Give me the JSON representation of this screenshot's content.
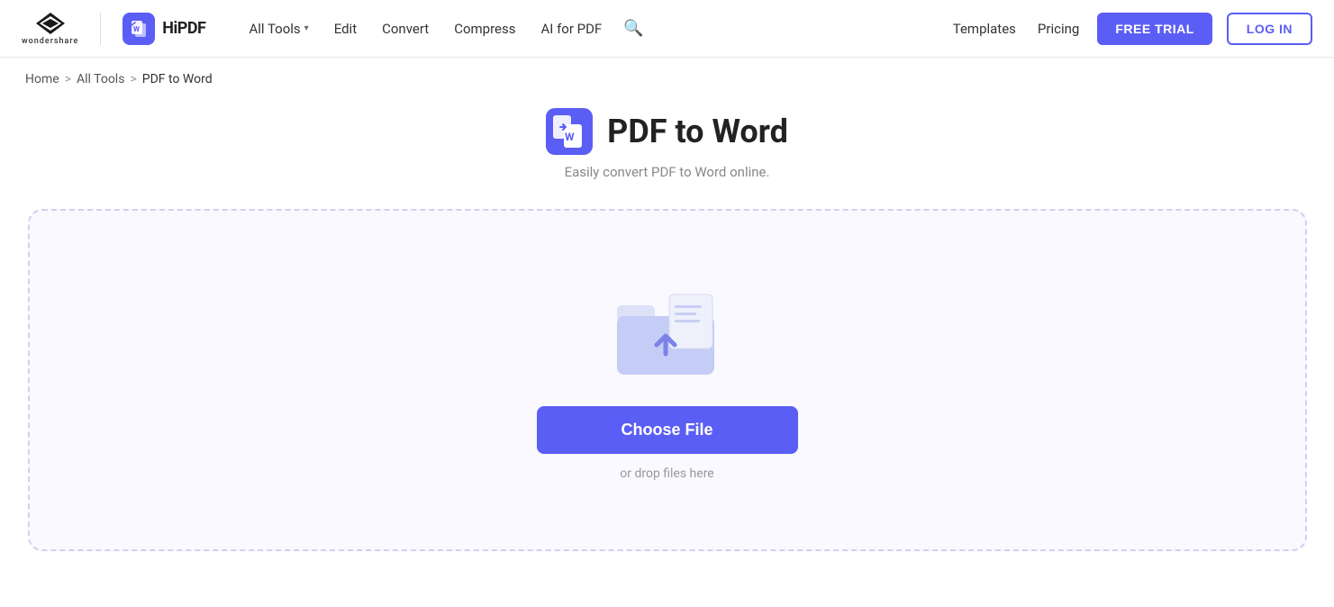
{
  "brand": {
    "wondershare_name": "wondershare",
    "hipdf_label": "HiPDF"
  },
  "nav": {
    "all_tools_label": "All Tools",
    "edit_label": "Edit",
    "convert_label": "Convert",
    "compress_label": "Compress",
    "ai_label": "AI for PDF",
    "templates_label": "Templates",
    "pricing_label": "Pricing",
    "free_trial_label": "FREE TRIAL",
    "login_label": "LOG IN"
  },
  "breadcrumb": {
    "home": "Home",
    "all_tools": "All Tools",
    "current": "PDF to Word",
    "sep": ">"
  },
  "page": {
    "title": "PDF to Word",
    "subtitle": "Easily convert PDF to Word online.",
    "choose_file_label": "Choose File",
    "drop_hint": "or drop files here"
  }
}
